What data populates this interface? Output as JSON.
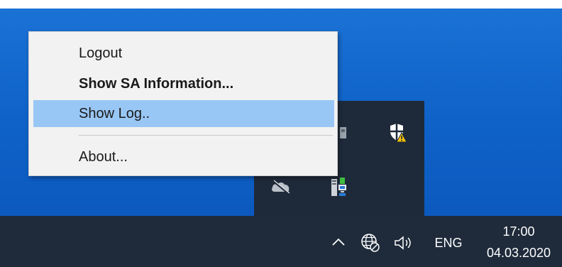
{
  "context_menu": {
    "items": [
      {
        "label": "Logout",
        "bold": false,
        "highlighted": false
      },
      {
        "label": "Show SA Information...",
        "bold": true,
        "highlighted": false
      },
      {
        "label": "Show Log..",
        "bold": false,
        "highlighted": true
      },
      {
        "label": "About...",
        "bold": false,
        "highlighted": false
      }
    ],
    "highlight_color": "#99c7f5"
  },
  "tray_flyout": {
    "icons": [
      "security-shield-warning-icon",
      "cloud-offline-icon",
      "network-device-icon",
      "partial-app-icon"
    ]
  },
  "taskbar": {
    "icons": [
      "chevron-up-icon",
      "globe-network-icon",
      "speaker-icon"
    ],
    "language": "ENG",
    "time": "17:00",
    "date": "04.03.2020"
  },
  "colors": {
    "desktop": "#0f62c8",
    "taskbar": "#1f2b3b",
    "menu_bg": "#f2f2f2"
  }
}
